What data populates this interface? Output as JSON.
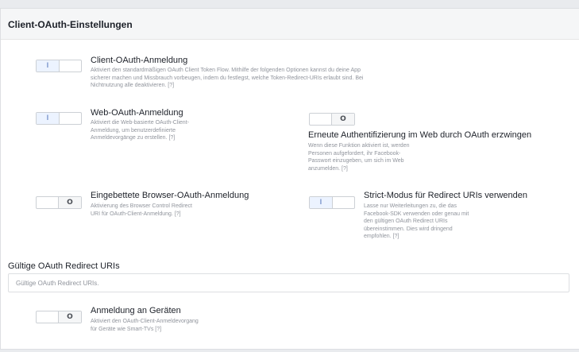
{
  "panel": {
    "title": "Client-OAuth-Einstellungen"
  },
  "options": {
    "client_oauth": {
      "toggle": "I",
      "state": "on",
      "title": "Client-OAuth-Anmeldung",
      "desc": [
        "Aktiviert den standardmäßigen OAuth Client Token Flow. Mithilfe der folgenden Optionen kannst du deine App",
        "sicherer machen und Missbrauch vorbeugen, indem du festlegst, welche Token-Redirect-URIs erlaubt sind. Bei",
        "Nichtnutzung alle deaktivieren.  [?]"
      ]
    },
    "web_oauth": {
      "toggle": "I",
      "state": "on",
      "title": "Web-OAuth-Anmeldung",
      "desc": [
        "Aktiviert die Web-basierte OAuth-Client-",
        "Anmeldung, um benutzerdefinierte",
        "Anmeldevorgänge zu erstellen.  [?]"
      ]
    },
    "force_reauth": {
      "toggle": "O",
      "state": "off",
      "title": "Erneute Authentifizierung im Web durch OAuth erzwingen",
      "desc": [
        "Wenn diese Funktion aktiviert ist, werden",
        "Personen aufgefordert, ihr Facebook-",
        "Passwort einzugeben, um sich im Web",
        "anzumelden.  [?]"
      ]
    },
    "embedded_browser": {
      "toggle": "O",
      "state": "off",
      "title": "Eingebettete Browser-OAuth-Anmeldung",
      "desc": [
        "Aktivierung des Browser Control Redirect",
        "URI für OAuth-Client-Anmeldung.  [?]"
      ]
    },
    "strict_mode": {
      "toggle": "I",
      "state": "on",
      "title": "Strict-Modus für Redirect URIs verwenden",
      "desc": [
        "Lasse nur Weiterleitungen zu, die das",
        "Facebook-SDK verwenden oder genau mit",
        "den gültigen OAuth Redirect URIs",
        "übereinstimmen. Dies wird dringend",
        "empfohlen.  [?]"
      ]
    },
    "device_login": {
      "toggle": "O",
      "state": "off",
      "title": "Anmeldung an Geräten",
      "desc": [
        "Aktiviert den OAuth-Client-Anmeldevorgang",
        "für Geräte wie Smart-TVs [?]"
      ]
    }
  },
  "redirect_uris": {
    "label": "Gültige OAuth Redirect URIs",
    "placeholder": "Gültige OAuth Redirect URIs.",
    "value": ""
  }
}
